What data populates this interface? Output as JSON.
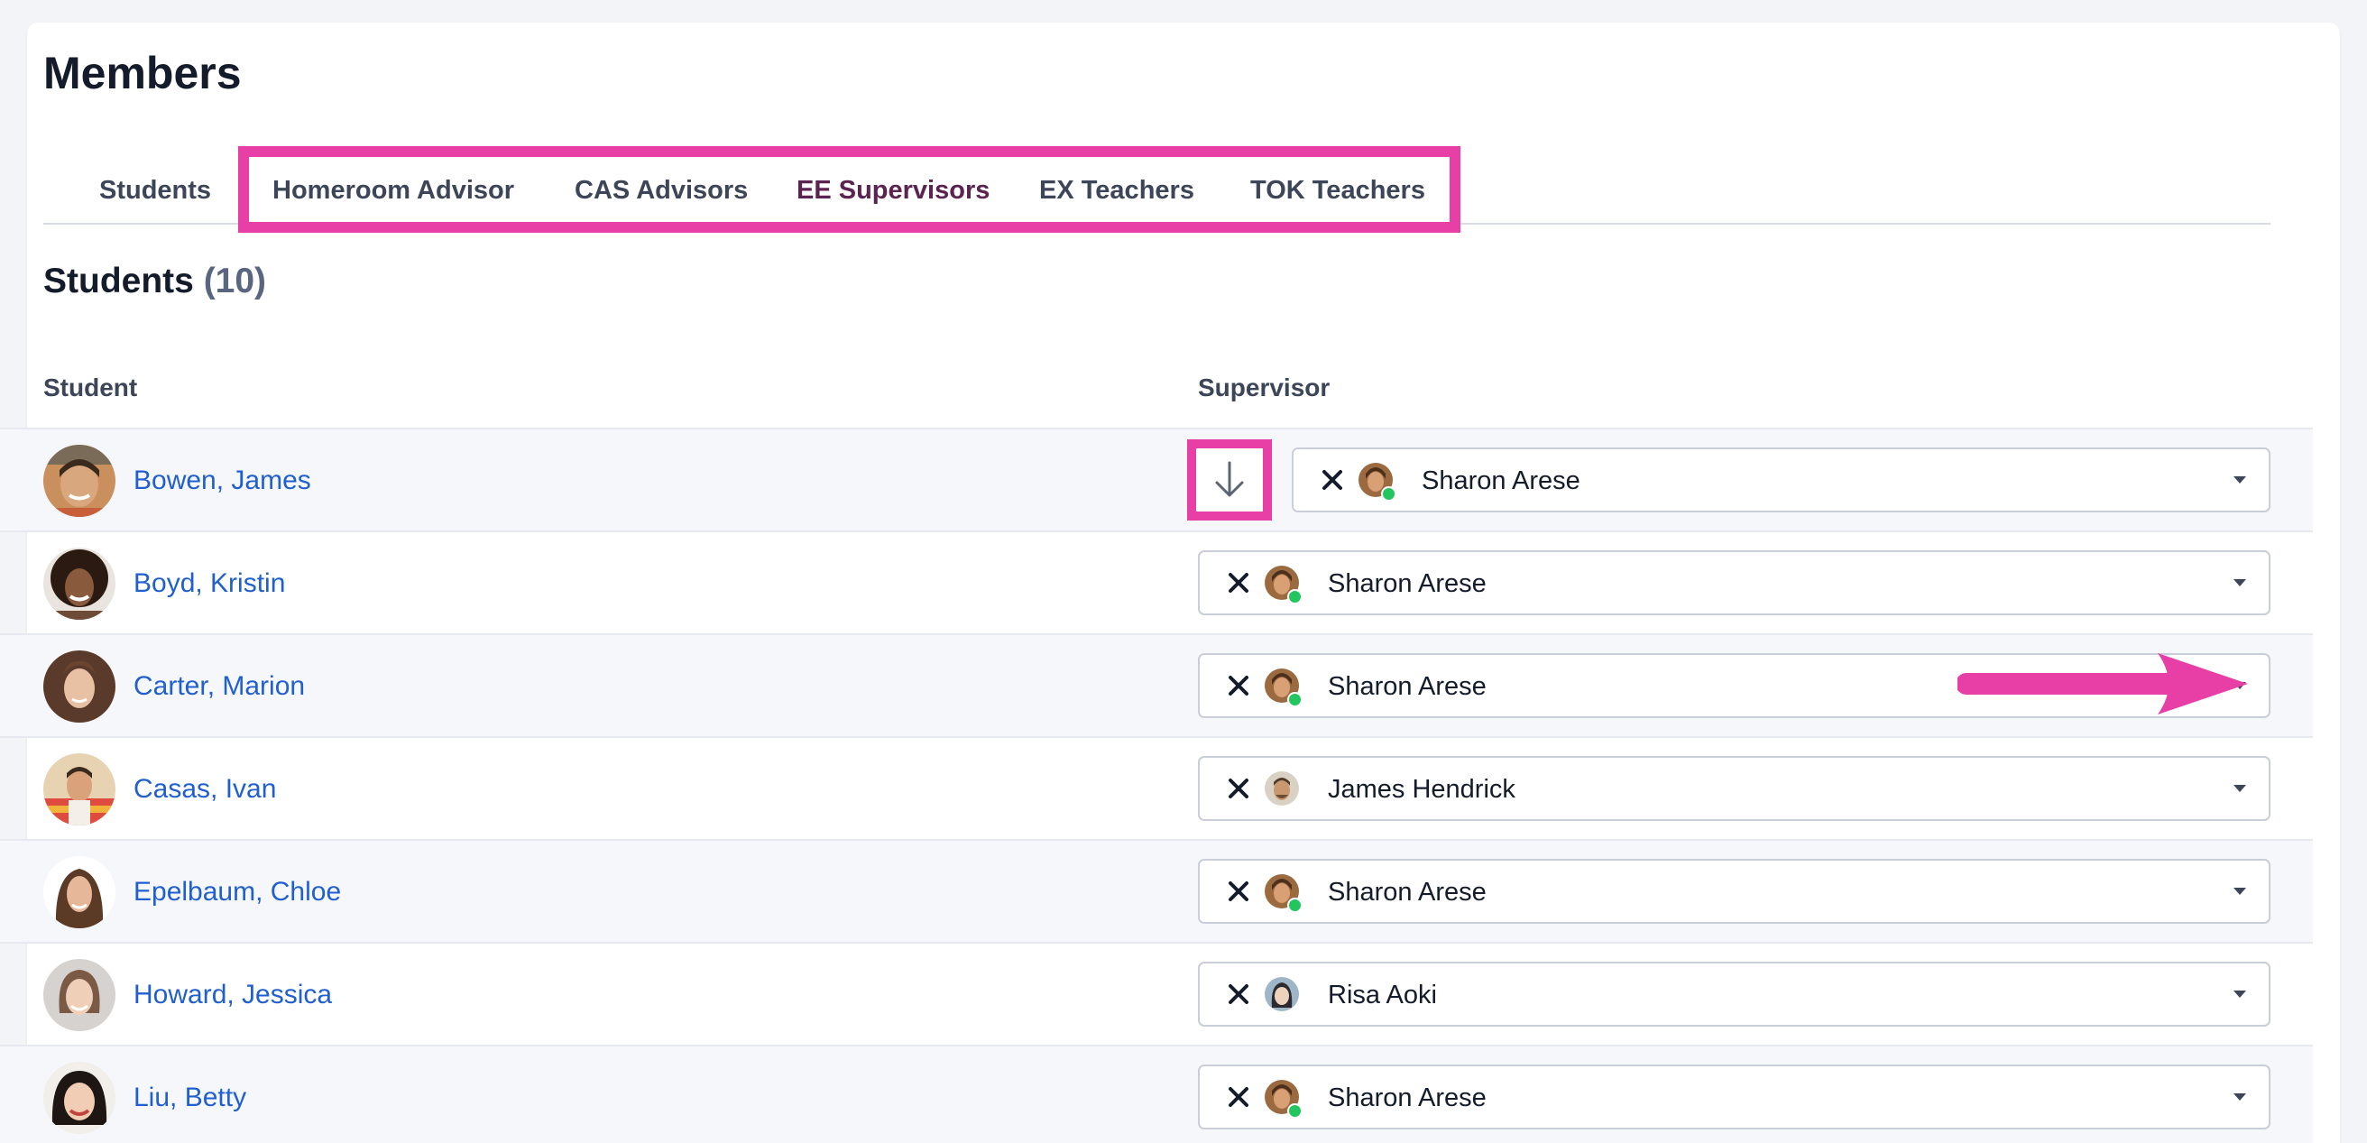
{
  "page": {
    "title": "Members"
  },
  "tabs": [
    {
      "label": "Students",
      "active": false
    },
    {
      "label": "Homeroom Advisor",
      "active": false
    },
    {
      "label": "CAS Advisors",
      "active": false
    },
    {
      "label": "EE Supervisors",
      "active": true
    },
    {
      "label": "EX Teachers",
      "active": false
    },
    {
      "label": "TOK Teachers",
      "active": false
    }
  ],
  "section": {
    "title": "Students",
    "count": "(10)"
  },
  "columns": {
    "student": "Student",
    "supervisor": "Supervisor"
  },
  "icons": {
    "fill_down": "arrow-down-icon",
    "clear": "close-icon",
    "dropdown": "caret-down-icon",
    "callout": "arrow-right-icon"
  },
  "colors": {
    "highlight": "#e83fa6",
    "link": "#1f5fcf",
    "active_tab": "#5a2350",
    "online": "#22c55e"
  },
  "rows": [
    {
      "student": "Bowen, James",
      "supervisor": "Sharon Arese"
    },
    {
      "student": "Boyd, Kristin",
      "supervisor": "Sharon Arese"
    },
    {
      "student": "Carter, Marion",
      "supervisor": "Sharon Arese"
    },
    {
      "student": "Casas, Ivan",
      "supervisor": "James Hendrick"
    },
    {
      "student": "Epelbaum, Chloe",
      "supervisor": "Sharon Arese"
    },
    {
      "student": "Howard, Jessica",
      "supervisor": "Risa Aoki"
    },
    {
      "student": "Liu, Betty",
      "supervisor": "Sharon Arese"
    }
  ]
}
